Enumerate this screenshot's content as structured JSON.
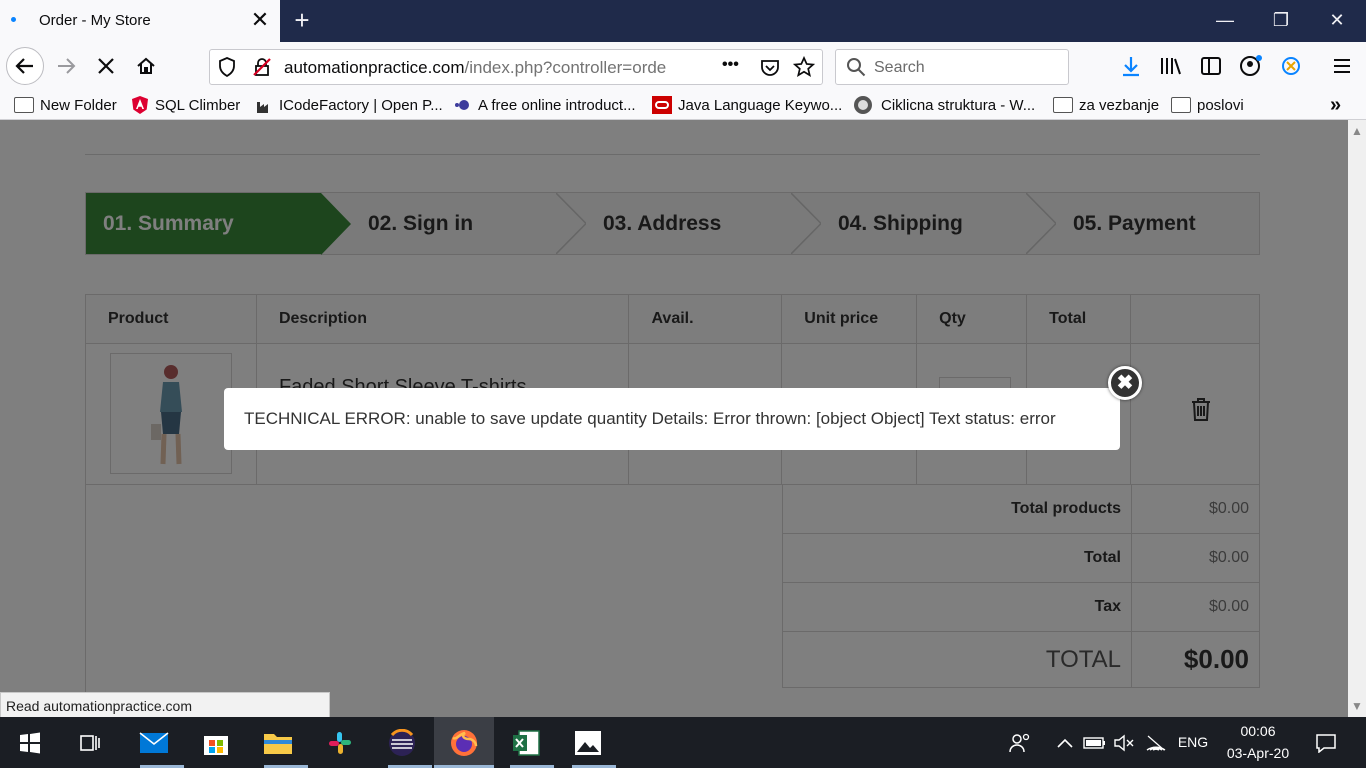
{
  "browser": {
    "tab_title": "Order - My Store",
    "tab_close": "✕",
    "new_tab": "+",
    "url_main": "automationpractice.com",
    "url_rest": "/index.php?controller=orde",
    "search_placeholder": "Search",
    "page_actions": "•••"
  },
  "bookmarks": [
    {
      "label": "New Folder",
      "icon": "folder-icon"
    },
    {
      "label": "SQL Climber",
      "icon": "angular-icon"
    },
    {
      "label": "ICodeFactory | Open P...",
      "icon": "factory-icon"
    },
    {
      "label": "A free online introduct...",
      "icon": "dot-icon"
    },
    {
      "label": "Java Language Keywo...",
      "icon": "oracle-icon"
    },
    {
      "label": "Ciklicna struktura - W...",
      "icon": "globe-icon"
    },
    {
      "label": "za vezbanje",
      "icon": "folder-icon"
    },
    {
      "label": "poslovi",
      "icon": "folder-icon"
    }
  ],
  "steps": [
    "01. Summary",
    "02. Sign in",
    "03. Address",
    "04. Shipping",
    "05. Payment"
  ],
  "cart": {
    "headers": [
      "Product",
      "Description",
      "Avail.",
      "Unit price",
      "Qty",
      "Total"
    ],
    "product_name": "Faded Short Sleeve T-shirts"
  },
  "summary": {
    "total_products_label": "Total products",
    "total_products_value": "$0.00",
    "total_label": "Total",
    "total_value": "$0.00",
    "tax_label": "Tax",
    "tax_value": "$0.00",
    "grand_total_label": "TOTAL",
    "grand_total_value": "$0.00"
  },
  "modal": {
    "message": "TECHNICAL ERROR: unable to save update quantity Details: Error thrown: [object Object] Text status: error"
  },
  "status_bar": "Read automationpractice.com",
  "taskbar": {
    "time": "00:06",
    "date": "03-Apr-20",
    "lang": "ENG"
  },
  "colors": {
    "step_active": "#3a8a3a",
    "tabbar": "#1f2a4a",
    "taskbar": "#1b1e24"
  }
}
